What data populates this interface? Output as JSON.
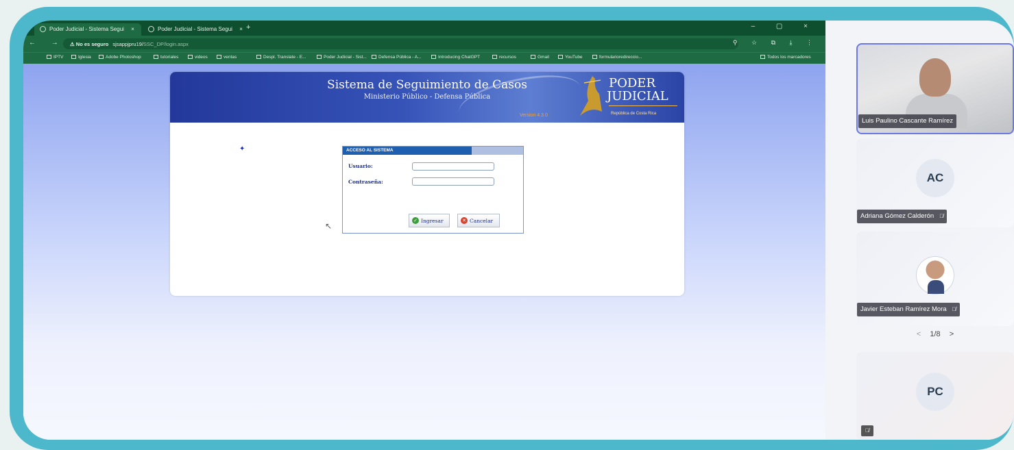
{
  "browser": {
    "tabs": [
      {
        "title": "Poder Judicial - Sistema Segui",
        "close": "×"
      },
      {
        "title": "Poder Judicial - Sistema Segui",
        "close": "×"
      }
    ],
    "new_tab": "+",
    "window_controls": "– ▢ ×",
    "nav_buttons": "← → C",
    "address": {
      "warning": "⚠ No es seguro",
      "host": "sjsappjpru19/",
      "path": "SSC_DP/login.aspx"
    },
    "address_icons": "⚲ ☆ ⧉ ⤓ ⋮",
    "bookmarks": [
      "IPTV",
      "Iglesia",
      "Adobe Photoshop",
      "tutoriales",
      "videos",
      "ventas",
      "Despl. Translate - E...",
      "Poder Judicial - Sist...",
      "Defensa Pública - A...",
      "Introducing ChatGPT",
      "recursos",
      "Gmail",
      "YouTube",
      "formularioredireccio...",
      "Todos los marcadores"
    ]
  },
  "page": {
    "banner_title": "Sistema de Seguimiento de Casos",
    "banner_subtitle": "Ministerio Público - Defensa Pública",
    "version": "Version 4.3.0",
    "logo_line1": "PODER",
    "logo_line2": "JUDICIAL",
    "logo_line3": "República de Costa Rica",
    "login": {
      "header": "ACCESO AL SISTEMA",
      "user_label": "Usuario:",
      "password_label": "Contraseña:",
      "user_value": "",
      "password_value": "",
      "submit_label": "Ingresar",
      "cancel_label": "Cancelar"
    }
  },
  "participants": {
    "tiles": [
      {
        "name": "Luis Paulino Cascante Ramírez",
        "type": "video"
      },
      {
        "name": "Adriana Gómez Calderón",
        "initials": "AC",
        "muted": true
      },
      {
        "name": "Javier Esteban Ramírez Mora",
        "type": "photo",
        "muted": true
      },
      {
        "name": "",
        "initials": "PC",
        "muted": true
      }
    ],
    "pager": {
      "prev": "<",
      "label": "1/8",
      "next": ">"
    }
  }
}
